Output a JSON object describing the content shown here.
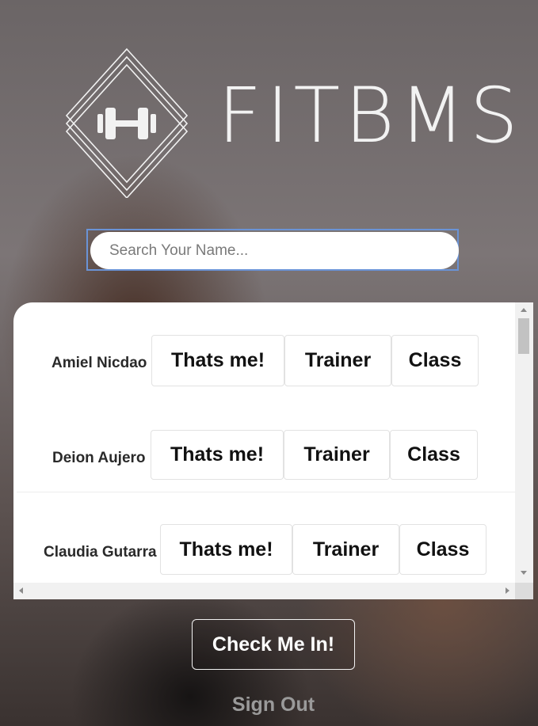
{
  "brand": {
    "name": "FITBMS",
    "icon": "dumbbell-diamond-icon"
  },
  "search": {
    "placeholder": "Search Your Name...",
    "value": ""
  },
  "members": [
    {
      "name": "Amiel Nicdao",
      "checkin_label": "Thats me!",
      "trainer_label": "Trainer",
      "class_label": "Class"
    },
    {
      "name": "Deion Aujero",
      "checkin_label": "Thats me!",
      "trainer_label": "Trainer",
      "class_label": "Class"
    },
    {
      "name": "Claudia Gutarra",
      "checkin_label": "Thats me!",
      "trainer_label": "Trainer",
      "class_label": "Class"
    }
  ],
  "actions": {
    "check_in_label": "Check Me In!",
    "sign_out_label": "Sign Out"
  },
  "colors": {
    "search_focus": "#6a93d6",
    "panel": "#ffffff",
    "sign_out": "#9a9a9a"
  }
}
